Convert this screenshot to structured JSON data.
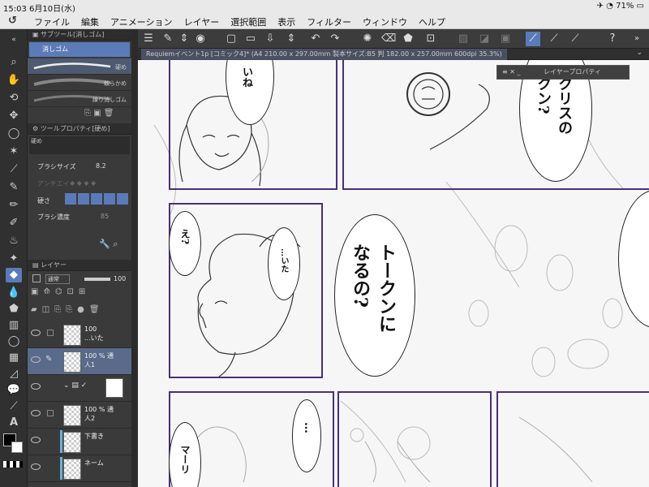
{
  "status_bar": {
    "time": "15:03",
    "date": "6月10日(水)",
    "battery": "71%"
  },
  "menu": {
    "items": [
      "ファイル",
      "編集",
      "アニメーション",
      "レイヤー",
      "選択範囲",
      "表示",
      "フィルター",
      "ウィンドウ",
      "ヘルプ"
    ]
  },
  "subtool_panel": {
    "title": "サブツール[消しゴム]",
    "group": "消しゴム",
    "brushes": [
      {
        "name": "硬め"
      },
      {
        "name": "軟らかめ"
      },
      {
        "name": "練り消しゴム"
      }
    ]
  },
  "tool_property": {
    "title": "ツールプロパティ[硬め]",
    "preview_name": "硬め",
    "brush_size_label": "ブラシサイズ",
    "brush_size_value": "8.2",
    "antialias_label": "アンチエイ",
    "hardness_label": "硬さ",
    "brush_density_label": "ブラシ濃度",
    "brush_density_value": "85"
  },
  "layer_panel": {
    "title": "レイヤー",
    "blend_mode": "通常",
    "opacity": "100",
    "layers": [
      {
        "line1": "100",
        "line2": "...いた",
        "selected": false
      },
      {
        "line1": "100 % 通",
        "line2": "人1",
        "selected": true
      },
      {
        "line1": "",
        "line2": "",
        "selected": false
      },
      {
        "line1": "100 % 通",
        "line2": "人2",
        "selected": false
      },
      {
        "line1": "",
        "line2": "下書き",
        "selected": false
      },
      {
        "line1": "",
        "line2": "ネーム",
        "selected": false
      }
    ]
  },
  "document_tab": {
    "title": "Requiemイベント1p [コミック4]* (A4 210.00 x 297.00mm 製本サイズ:B5 判 182.00 x 257.00mm 600dpi 35.3%)"
  },
  "layer_property_window": {
    "title": "レイヤープロパティ"
  },
  "canvas_text": {
    "balloon1": "クリスの\nクン?",
    "balloon2": "トークンに\nなるの?",
    "small1": "いね",
    "small2": "え?",
    "small3": "…いた",
    "small4": "…",
    "small5": "マーリ"
  },
  "colors": {
    "accent": "#5b7bb8",
    "frame": "#4a2f7a"
  }
}
